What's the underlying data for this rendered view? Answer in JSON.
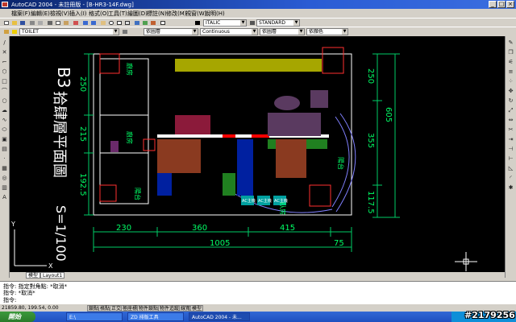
{
  "window": {
    "title": "AutoCAD 2004 - 未註冊版 - [B-HR3-14F.dwg]",
    "controls": [
      "_",
      "□",
      "×"
    ]
  },
  "menubar": {
    "items": [
      "檔案(F)",
      "編輯(E)",
      "檢視(V)",
      "插入(I)",
      "格式(O)",
      "工具(T)",
      "繪圖(D)",
      "標註(N)",
      "修改(M)",
      "視窗(W)",
      "說明(H)"
    ]
  },
  "toolbar": {
    "text_style": "ITALIC",
    "dim_style": "STANDARD",
    "layer_name": "TOILET",
    "color": "依圖層",
    "linetype": "Continuous",
    "lineweight": "依圖層",
    "plotstyle": "依顏色"
  },
  "drawing": {
    "title_code": "B3",
    "title_text": "拾肆層平面圖",
    "scale": "S=1/100",
    "room_labels": [
      "廚房",
      "廚房",
      "陽台",
      "臥房",
      "陽台"
    ],
    "tag_labels": [
      "AC主機",
      "AC主機",
      "AC主機"
    ],
    "dims_left": [
      "250",
      "215",
      "192.5"
    ],
    "dims_right": [
      "250",
      "355",
      "117.5",
      "605"
    ],
    "dims_bottom": [
      "230",
      "360",
      "415",
      "75"
    ],
    "dim_total": "1005",
    "axis_y": "Y",
    "axis_x": "X"
  },
  "layout_tabs": [
    "模型",
    "Layout1"
  ],
  "command": {
    "line1": "指令: 指定對角點: *取消*",
    "line2": "指令: *取消*",
    "line3": "指令:"
  },
  "status": {
    "coords": "21859.80, 199.54, 0.00",
    "buttons": [
      "鎖點",
      "格點",
      "正交",
      "極座標",
      "物件鎖點",
      "物件追蹤",
      "線寬",
      "模型"
    ]
  },
  "taskbar": {
    "start_label": "開始",
    "tasks": [
      "E:\\",
      "ZD 排版工具",
      "AutoCAD 2004 - 未..."
    ]
  },
  "watermark": "#2179256",
  "colors": {
    "titlebar": "#0a246a",
    "canvas": "#000000"
  }
}
